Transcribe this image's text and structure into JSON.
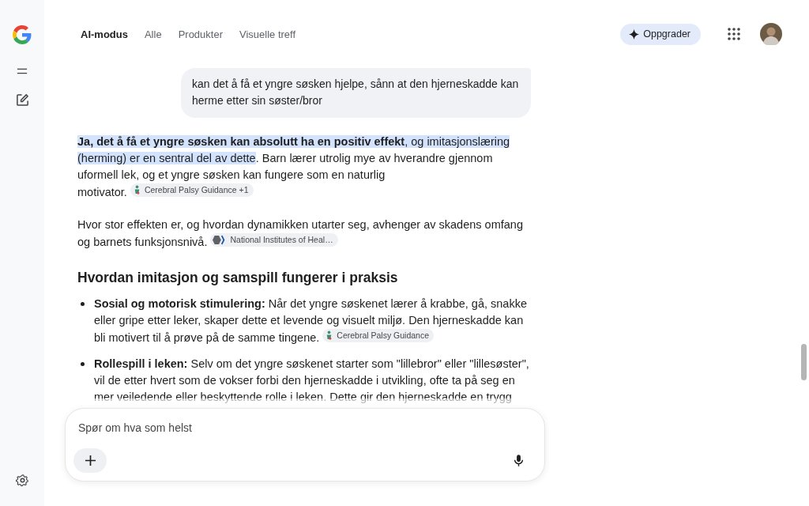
{
  "nav": {
    "tabs": [
      {
        "label": "AI-modus",
        "selected": true
      },
      {
        "label": "Alle",
        "selected": false
      },
      {
        "label": "Produkter",
        "selected": false
      },
      {
        "label": "Visuelle treff",
        "selected": false
      }
    ],
    "upgrade": "Oppgrader"
  },
  "user_message": "kan det å få et yngre søsken hjelpe, sånn at den hjerneskadde kan herme etter sin søster/bror",
  "answer": [
    {
      "highlight": "**Ja, det å få et yngre søsken kan absolutt ha en positiv effekt**, og imitasjonslæring (herming) er en sentral del av dette",
      "text": ". Barn lærer utrolig mye av hverandre gjennom uformell lek, og et yngre søsken kan fungere som en naturlig motivator.",
      "chip": {
        "kind": "figure",
        "label": "Cerebral Palsy Guidance +1"
      }
    },
    {
      "text": "Hvor stor effekten er, og hvordan dynamikken utarter seg, avhenger av skadens omfang og barnets funksjonsnivå.",
      "chip": {
        "kind": "hexagon",
        "label": "National Institutes of Heal…"
      }
    }
  ],
  "heading": "Hvordan imitasjon og samspill fungerer i praksis",
  "bullets": [
    {
      "text": "**Sosial og motorisk stimulering:** Når det yngre søskenet lærer å krabbe, gå, snakke eller gripe etter leker, skaper dette et levende og visuelt miljø. Den hjerneskadde kan bli motivert til å prøve på de samme tingene.",
      "chip": {
        "kind": "figure",
        "label": "Cerebral Palsy Guidance"
      }
    },
    {
      "text": "**Rollespill i leken:** Selv om det yngre søskenet starter som \"lillebror\" eller \"lillesøster\", vil de etter hvert som de vokser forbi den hjerneskadde i utvikling, ofte ta på seg en mer veiledende eller beskyttende rolle i leken. Dette gir den hjerneskadde en trygg"
    }
  ],
  "composer": {
    "placeholder": "Spør om hva som helst"
  }
}
